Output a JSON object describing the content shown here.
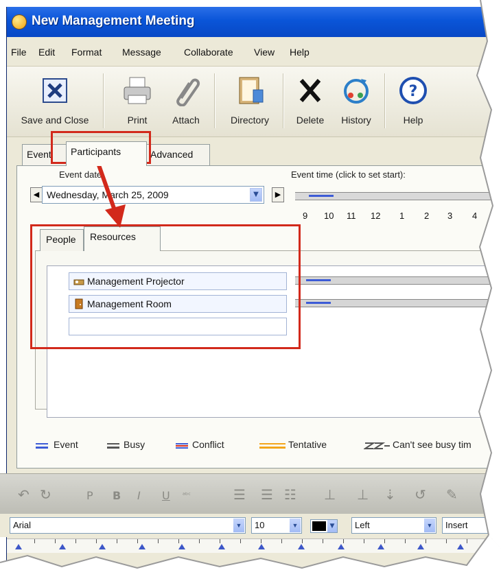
{
  "window": {
    "title": "New Management Meeting"
  },
  "menu": [
    "File",
    "Edit",
    "Format",
    "Message",
    "Collaborate",
    "View",
    "Help"
  ],
  "toolbar": {
    "save_close": "Save and Close",
    "print": "Print",
    "attach": "Attach",
    "directory": "Directory",
    "delete": "Delete",
    "history": "History",
    "help": "Help"
  },
  "tabs": {
    "event": "Event",
    "participants": "Participants",
    "advanced": "Advanced"
  },
  "event_date": {
    "label": "Event date:",
    "value": "Wednesday, March 25, 2009"
  },
  "event_time": {
    "label": "Event time (click to set start):",
    "hours": [
      "9",
      "10",
      "11",
      "12",
      "1",
      "2",
      "3",
      "4"
    ]
  },
  "subtabs": {
    "people": "People",
    "resources": "Resources"
  },
  "resources": [
    "Management Projector",
    "Management Room",
    ""
  ],
  "legend": {
    "event": "Event",
    "busy": "Busy",
    "conflict": "Conflict",
    "tentative": "Tentative",
    "cant_see": "Can't see busy tim"
  },
  "format_bar": {
    "font": "Arial",
    "size": "10",
    "align": "Left",
    "insert": "Insert"
  },
  "colors": {
    "accent": "#0a55d8",
    "highlight": "#d2291b",
    "event": "#3c5bd6",
    "conflict": "#d2291b",
    "tentative": "#f3a51a"
  }
}
